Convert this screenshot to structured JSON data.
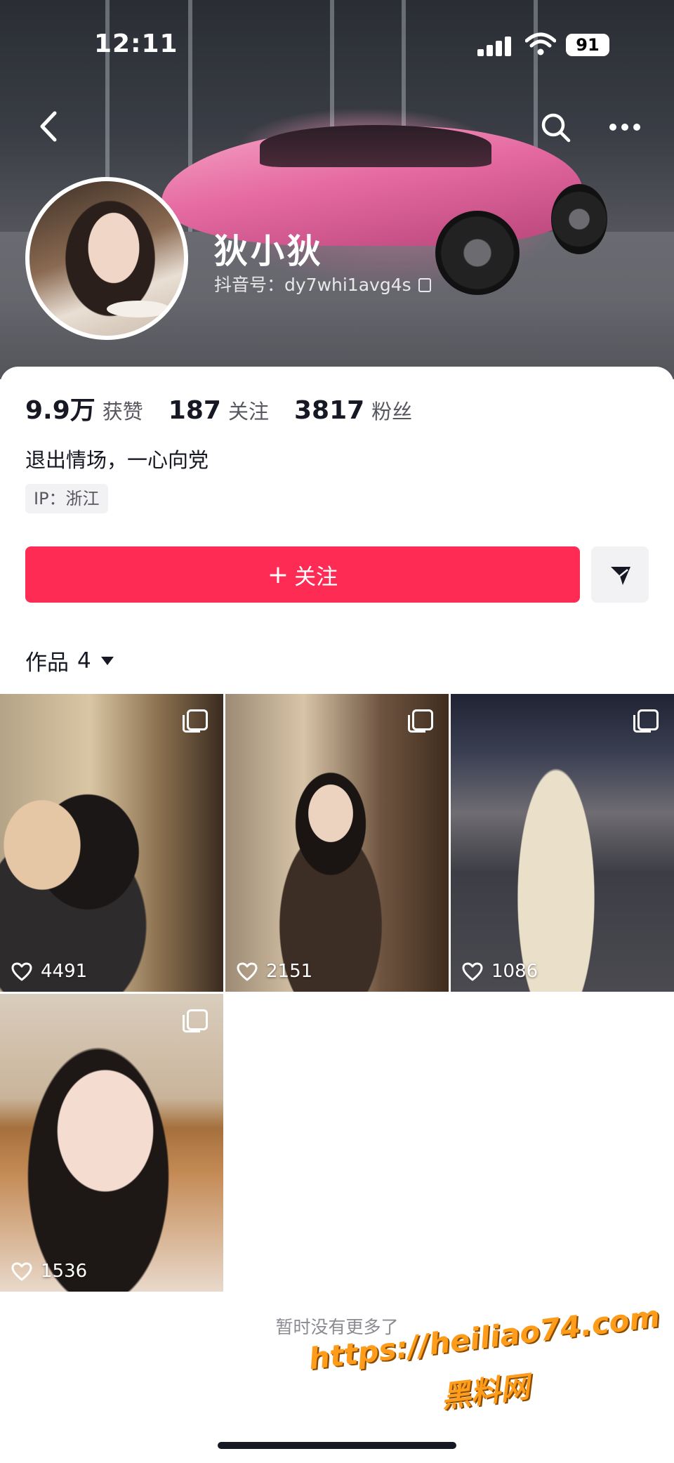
{
  "status_bar": {
    "time": "12:11",
    "battery": "91"
  },
  "profile": {
    "nickname": "狄小狄",
    "douyin_id": "抖音号：dy7whi1avg4s",
    "stats": [
      {
        "value": "9.9万",
        "label": "获赞"
      },
      {
        "value": "187",
        "label": "关注"
      },
      {
        "value": "3817",
        "label": "粉丝"
      }
    ],
    "bio": "退出情场，一心向党",
    "ip": "IP：浙江"
  },
  "actions": {
    "follow_plus": "+",
    "follow_label": "关注"
  },
  "works": {
    "tab_label": "作品",
    "count": "4",
    "items": [
      {
        "likes": "4491"
      },
      {
        "likes": "2151"
      },
      {
        "likes": "1086"
      },
      {
        "likes": "1536"
      }
    ]
  },
  "footer": {
    "no_more": "暂时没有更多了",
    "watermark_url": "https://heiliao74.com",
    "watermark_name": "黑料网"
  },
  "colors": {
    "accent": "#fe2c55",
    "text": "#161823",
    "muted": "#57585f"
  },
  "icons": [
    "back-arrow-icon",
    "search-icon",
    "more-icon",
    "copy-icon",
    "share-icon",
    "caret-down-icon",
    "multi-image-icon",
    "heart-icon"
  ]
}
